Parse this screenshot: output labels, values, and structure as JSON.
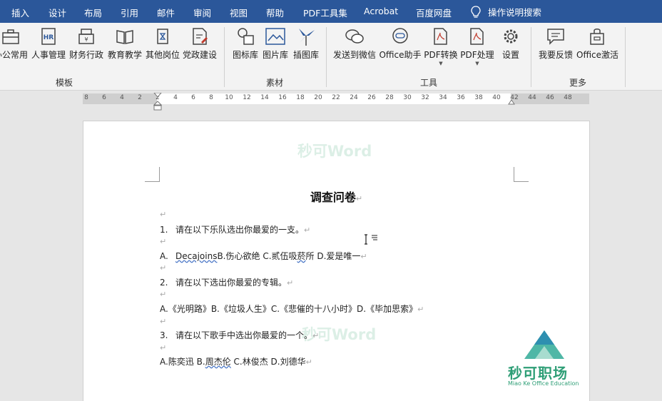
{
  "menu_tabs": [
    "插入",
    "设计",
    "布局",
    "引用",
    "邮件",
    "审阅",
    "视图",
    "帮助",
    "PDF工具集",
    "Acrobat",
    "百度网盘"
  ],
  "menu_search": "操作说明搜索",
  "ribbon": {
    "template_buttons": [
      "办公常用",
      "人事管理",
      "财务行政",
      "教育教学",
      "其他岗位",
      "党政建设"
    ],
    "material_buttons": [
      "图标库",
      "图片库",
      "插图库"
    ],
    "tool_buttons": [
      "发送到微信",
      "Office助手",
      "PDF转换",
      "PDF处理",
      "设置"
    ],
    "more_buttons": [
      "我要反馈",
      "Office激活"
    ],
    "groups": [
      "模板",
      "素材",
      "工具",
      "更多"
    ]
  },
  "ruler_numbers": [
    "8",
    "6",
    "4",
    "2",
    "2",
    "4",
    "6",
    "8",
    "10",
    "12",
    "14",
    "16",
    "18",
    "20",
    "22",
    "24",
    "26",
    "28",
    "30",
    "32",
    "34",
    "36",
    "38",
    "40",
    "42",
    "44",
    "46",
    "48"
  ],
  "watermark": "秒可Word",
  "document": {
    "title": "调查问卷",
    "q1_num": "1.",
    "q1": "请在以下乐队选出你最爱的一支。",
    "a1_prefix": "A.",
    "a1_wavy": "Decajoins",
    "a1_mid": "B.伤心欲绝 C.贰伍吸",
    "a1_wavy2": "菸",
    "a1_end": "所 D.爱是唯一",
    "q2_num": "2.",
    "q2": "请在以下选出你最爱的专辑。",
    "a2": "A.《光明路》B.《垃圾人生》C.《悲催的十八小时》D.《毕加思索》",
    "q3_num": "3.",
    "q3": "请在以下歌手中选出你最爱的一个。",
    "a3_pre": "A.陈奕迅 B.",
    "a3_wavy": "周杰伦",
    "a3_end": " C.林俊杰 D.刘德华"
  },
  "logo": {
    "name": "秒可职场",
    "sub": "Miao Ke Office Education"
  }
}
